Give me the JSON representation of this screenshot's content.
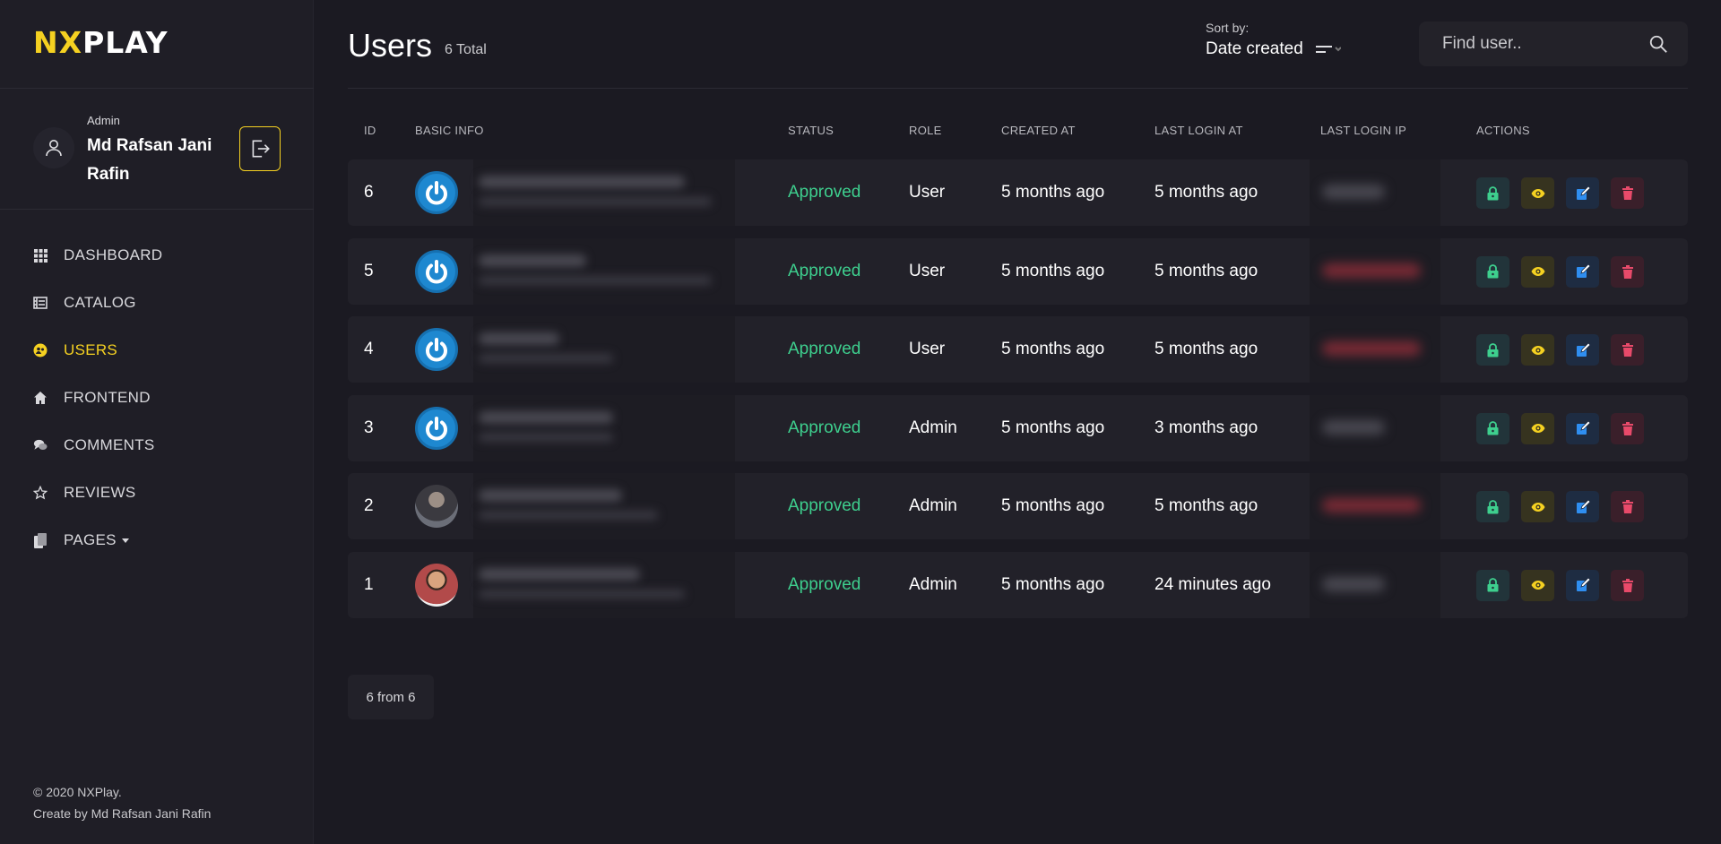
{
  "brand": {
    "part1": "NX",
    "part2": "PLAY"
  },
  "user": {
    "role": "Admin",
    "name": "Md Rafsan Jani Rafin"
  },
  "nav": [
    {
      "label": "DASHBOARD",
      "icon": "grid-icon",
      "active": false
    },
    {
      "label": "CATALOG",
      "icon": "film-icon",
      "active": false
    },
    {
      "label": "USERS",
      "icon": "users-icon",
      "active": true
    },
    {
      "label": "FRONTEND",
      "icon": "home-icon",
      "active": false
    },
    {
      "label": "COMMENTS",
      "icon": "comments-icon",
      "active": false
    },
    {
      "label": "REVIEWS",
      "icon": "star-icon",
      "active": false
    },
    {
      "label": "PAGES",
      "icon": "pages-icon",
      "active": false,
      "dropdown": true
    }
  ],
  "footer": {
    "copyright": "© 2020 NXPlay.",
    "credit": "Create by Md Rafsan Jani Rafin"
  },
  "header": {
    "title": "Users",
    "total": "6 Total",
    "sort_label": "Sort by:",
    "sort_value": "Date created",
    "search_placeholder": "Find user.."
  },
  "table": {
    "columns": [
      "ID",
      "BASIC INFO",
      "STATUS",
      "ROLE",
      "CREATED AT",
      "LAST LOGIN AT",
      "LAST LOGIN IP",
      "ACTIONS"
    ],
    "rows": [
      {
        "id": "6",
        "status": "Approved",
        "role": "User",
        "created": "5 months ago",
        "last_login": "5 months ago",
        "avatar": "power-icon",
        "ip_color": "#4a4952"
      },
      {
        "id": "5",
        "status": "Approved",
        "role": "User",
        "created": "5 months ago",
        "last_login": "5 months ago",
        "avatar": "power-icon",
        "ip_color": "#7a2a35"
      },
      {
        "id": "4",
        "status": "Approved",
        "role": "User",
        "created": "5 months ago",
        "last_login": "5 months ago",
        "avatar": "power-icon",
        "ip_color": "#7a2a35"
      },
      {
        "id": "3",
        "status": "Approved",
        "role": "Admin",
        "created": "5 months ago",
        "last_login": "3 months ago",
        "avatar": "power-icon",
        "ip_color": "#4a4952"
      },
      {
        "id": "2",
        "status": "Approved",
        "role": "Admin",
        "created": "5 months ago",
        "last_login": "5 months ago",
        "avatar": "photo",
        "ip_color": "#7a2a35"
      },
      {
        "id": "1",
        "status": "Approved",
        "role": "Admin",
        "created": "5 months ago",
        "last_login": "24 minutes ago",
        "avatar": "photo",
        "ip_color": "#4a4952"
      }
    ]
  },
  "pagination": {
    "label": "6 from 6"
  },
  "colors": {
    "accent": "#f5d121",
    "approved": "#3ecf8e",
    "background": "#1b1a22"
  }
}
